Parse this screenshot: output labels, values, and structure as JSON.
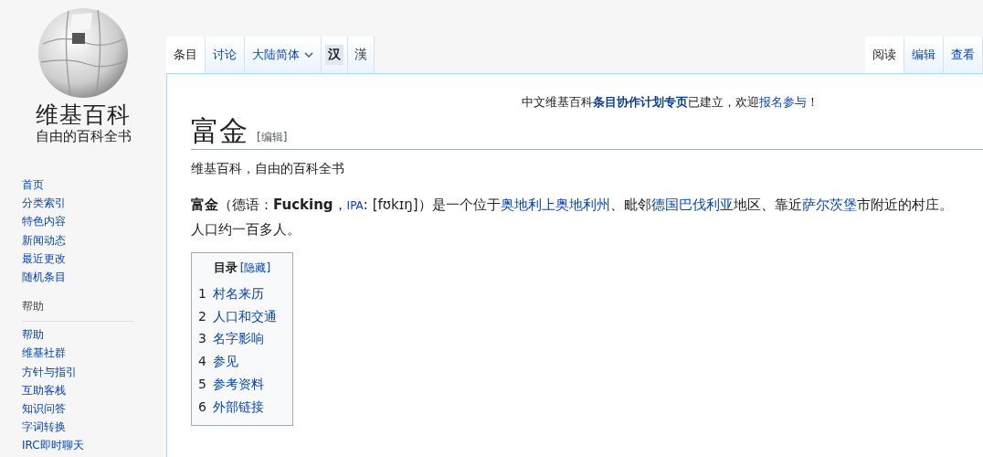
{
  "logo": {
    "title": "维基百科",
    "subtitle": "自由的百科全书"
  },
  "sidebar": {
    "groups": [
      {
        "items": [
          "首页",
          "分类索引",
          "特色内容",
          "新闻动态",
          "最近更改",
          "随机条目"
        ]
      },
      {
        "heading": "帮助",
        "items": [
          "帮助",
          "维基社群",
          "方针与指引",
          "互助客栈",
          "知识问答",
          "字词转换",
          "IRC即时聊天"
        ]
      }
    ]
  },
  "tabs_left": [
    {
      "label": "条目",
      "selected": true,
      "kind": "tab"
    },
    {
      "label": "讨论",
      "selected": false,
      "kind": "tab"
    },
    {
      "label": "大陆简体",
      "selected": false,
      "kind": "dropdown"
    },
    {
      "label": "汉",
      "selected": true,
      "kind": "variant"
    },
    {
      "label": "漢",
      "selected": false,
      "kind": "variant"
    }
  ],
  "tabs_right": [
    {
      "label": "阅读",
      "selected": true
    },
    {
      "label": "编辑",
      "selected": false
    },
    {
      "label": "查看",
      "selected": false
    }
  ],
  "notice": [
    {
      "kind": "plain",
      "text": "中文维基百科"
    },
    {
      "kind": "link",
      "text": "条目协作计划专页"
    },
    {
      "kind": "plain",
      "text": "已建立，欢迎"
    },
    {
      "kind": "link",
      "text": "报名参与"
    },
    {
      "kind": "plain",
      "text": "！"
    }
  ],
  "article": {
    "title": "富金",
    "edit_link": "[编辑]",
    "tagline": "维基百科，自由的百科全书",
    "paragraph": [
      {
        "kind": "bold",
        "text": "富金"
      },
      {
        "kind": "plain",
        "text": "（德语："
      },
      {
        "kind": "bold",
        "text": "Fucking"
      },
      {
        "kind": "plain",
        "text": "，"
      },
      {
        "kind": "small-link",
        "text": "IPA"
      },
      {
        "kind": "plain",
        "text": ": [fʊkɪŋ]）是一个位于"
      },
      {
        "kind": "link",
        "text": "奥地利"
      },
      {
        "kind": "link",
        "text": "上奥地利州"
      },
      {
        "kind": "plain",
        "text": "、毗邻"
      },
      {
        "kind": "link",
        "text": "德国"
      },
      {
        "kind": "link",
        "text": "巴伐利亚"
      },
      {
        "kind": "plain",
        "text": "地区、靠近"
      },
      {
        "kind": "link",
        "text": "萨尔茨堡"
      },
      {
        "kind": "plain",
        "text": "市附近的村庄。人口约一百多人。"
      }
    ],
    "toc": {
      "title": "目录",
      "toggle": "[隐藏]",
      "items": [
        {
          "number": "1",
          "text": "村名来历"
        },
        {
          "number": "2",
          "text": "人口和交通"
        },
        {
          "number": "3",
          "text": "名字影响"
        },
        {
          "number": "4",
          "text": "参见"
        },
        {
          "number": "5",
          "text": "参考资料"
        },
        {
          "number": "6",
          "text": "外部链接"
        }
      ]
    }
  }
}
